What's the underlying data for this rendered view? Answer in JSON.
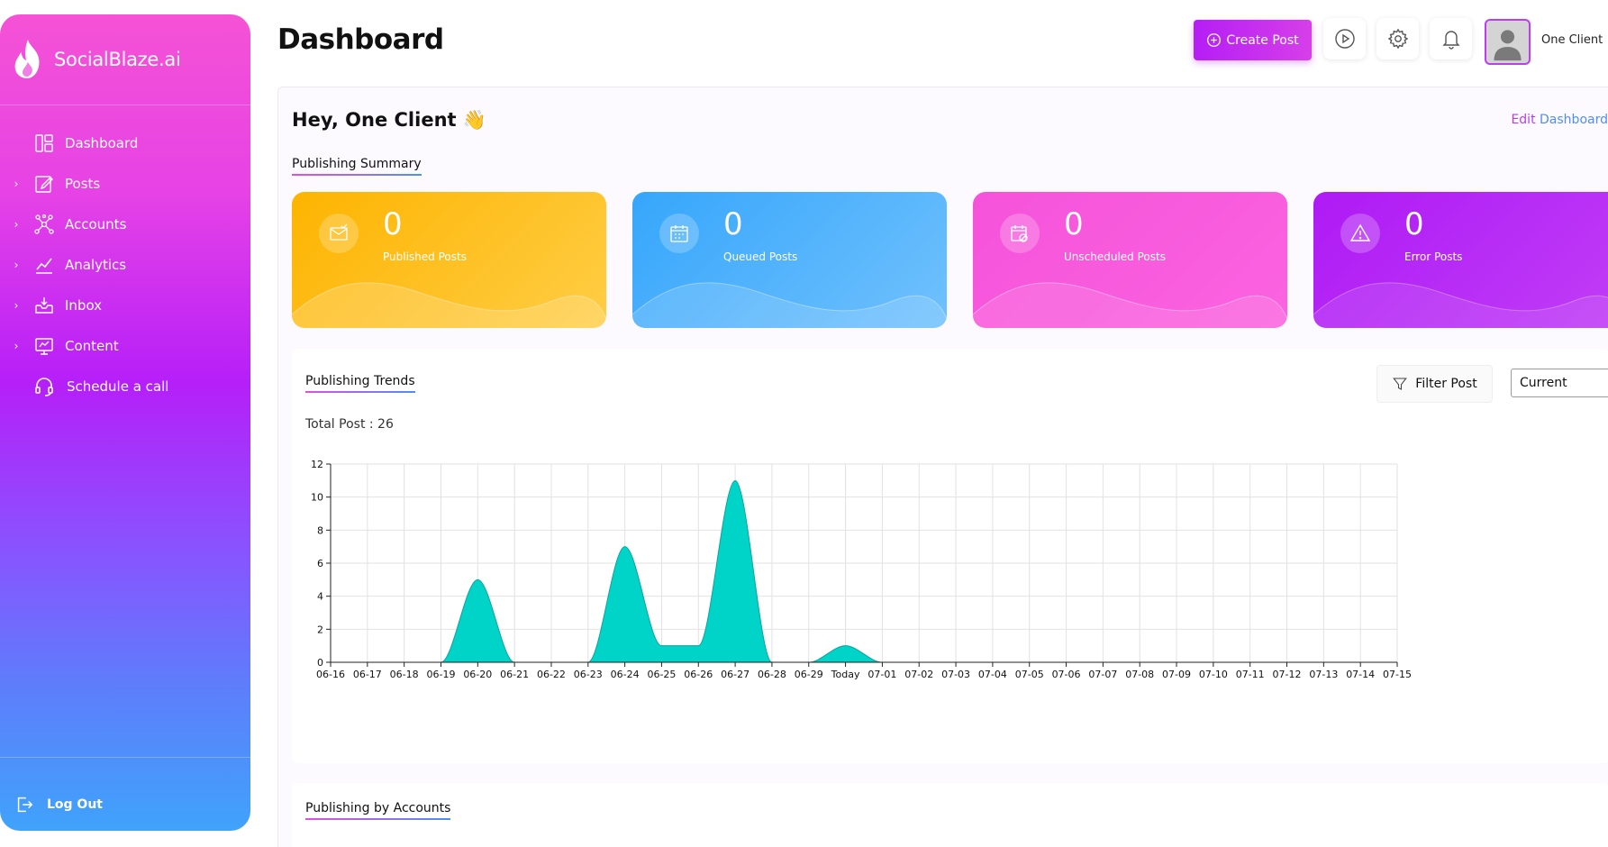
{
  "app": {
    "brand": "SocialBlaze.ai"
  },
  "sidebar": {
    "items": [
      {
        "label": "Dashboard",
        "icon": "dashboard-icon",
        "has_chevron": false
      },
      {
        "label": "Posts",
        "icon": "edit-icon",
        "has_chevron": true
      },
      {
        "label": "Accounts",
        "icon": "network-icon",
        "has_chevron": true
      },
      {
        "label": "Analytics",
        "icon": "chart-line-icon",
        "has_chevron": true
      },
      {
        "label": "Inbox",
        "icon": "inbox-icon",
        "has_chevron": true
      },
      {
        "label": "Content",
        "icon": "monitor-icon",
        "has_chevron": true
      },
      {
        "label": "Schedule a call",
        "icon": "headset-icon",
        "has_chevron": false
      }
    ],
    "logout": "Log Out"
  },
  "header": {
    "title": "Dashboard",
    "create_post": "Create Post",
    "user_name": "One Client"
  },
  "main": {
    "greeting": "Hey, One Client 👋",
    "edit_dashboard_part1": "Edit",
    "edit_dashboard_part2": "Dashboard",
    "summary_title": "Publishing Summary",
    "cards": [
      {
        "value": "0",
        "label": "Published Posts",
        "color": "#fdb813",
        "icon": "mail-check-icon"
      },
      {
        "value": "0",
        "label": "Queued Posts",
        "color": "#4ab0fb",
        "icon": "calendar-grid-icon"
      },
      {
        "value": "0",
        "label": "Unscheduled Posts",
        "color": "#f552d6",
        "icon": "calendar-off-icon"
      },
      {
        "value": "0",
        "label": "Error Posts",
        "color": "#b321f5",
        "icon": "warning-icon"
      }
    ],
    "trends_title": "Publishing Trends",
    "filter_label": "Filter Post",
    "period_select": "Current",
    "total_post": "Total Post : 26",
    "accounts_title": "Publishing by Accounts"
  },
  "chart_data": {
    "type": "area",
    "x": [
      "06-16",
      "06-17",
      "06-18",
      "06-19",
      "06-20",
      "06-21",
      "06-22",
      "06-23",
      "06-24",
      "06-25",
      "06-26",
      "06-27",
      "06-28",
      "06-29",
      "Today",
      "07-01",
      "07-02",
      "07-03",
      "07-04",
      "07-05",
      "07-06",
      "07-07",
      "07-08",
      "07-09",
      "07-10",
      "07-11",
      "07-12",
      "07-13",
      "07-14",
      "07-15"
    ],
    "values": [
      0,
      0,
      0,
      0,
      5,
      0,
      0,
      0,
      7,
      1,
      1,
      11,
      0,
      0,
      1,
      0,
      0,
      0,
      0,
      0,
      0,
      0,
      0,
      0,
      0,
      0,
      0,
      0,
      0,
      0
    ],
    "yticks": [
      0,
      2,
      4,
      6,
      8,
      10,
      12
    ],
    "ylim": [
      0,
      12
    ],
    "grid": true,
    "fill_color": "#00d3c8"
  }
}
